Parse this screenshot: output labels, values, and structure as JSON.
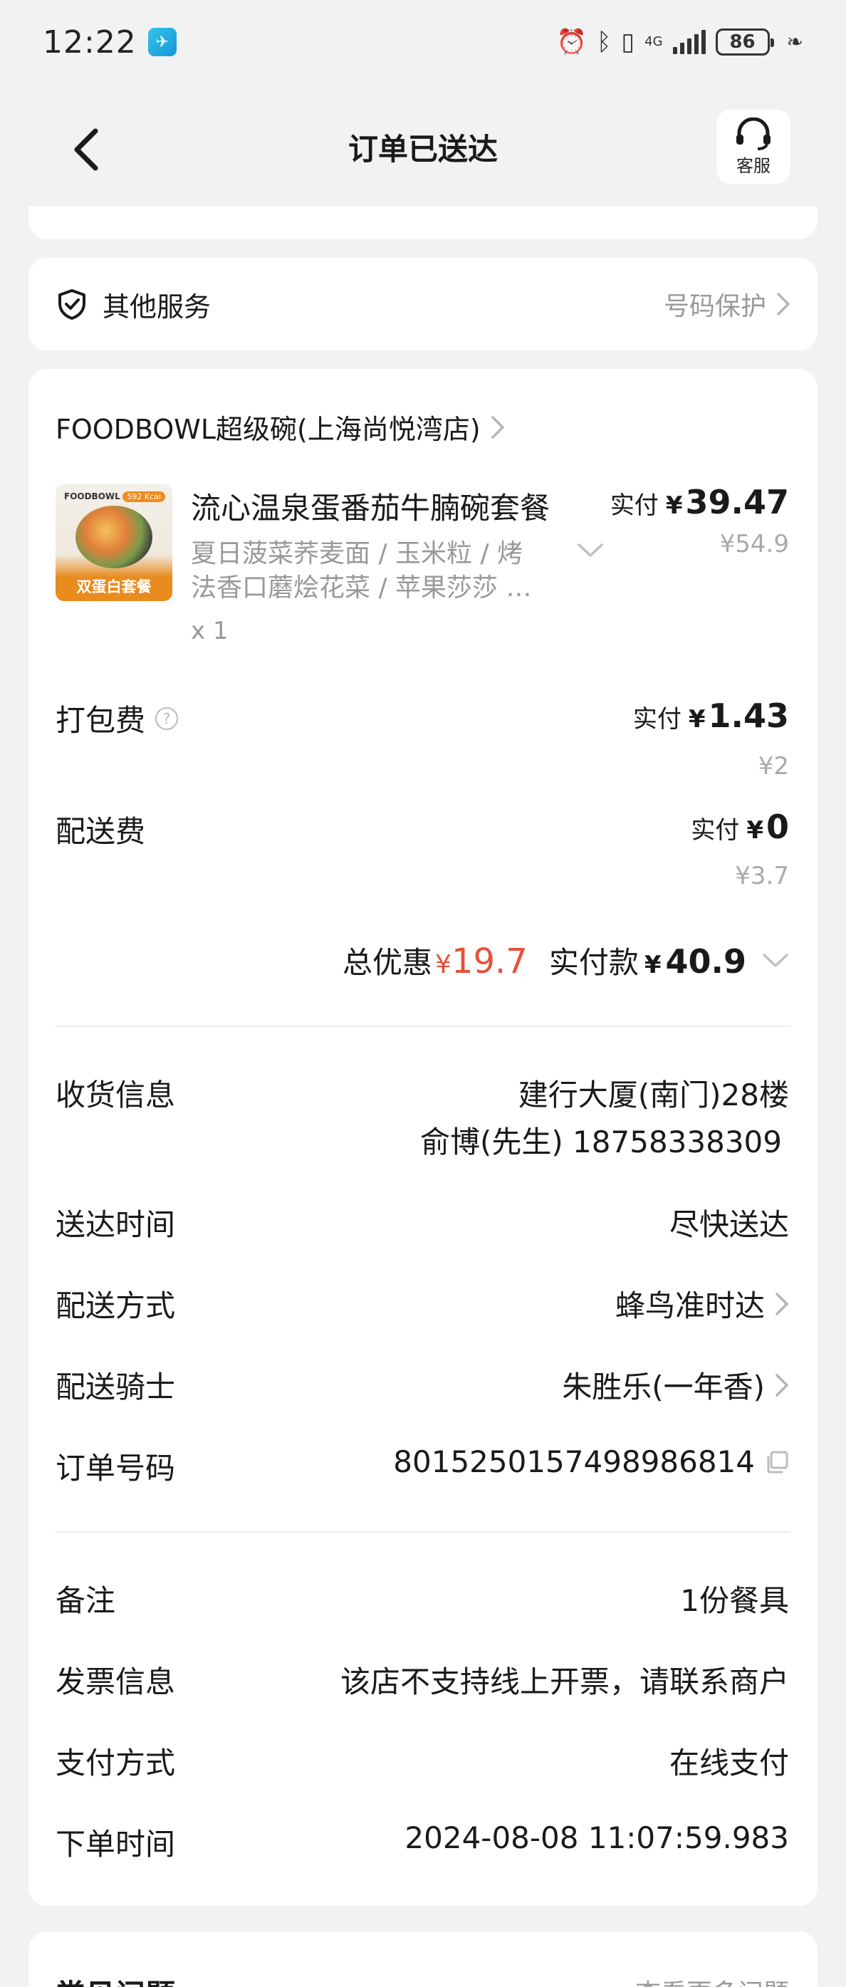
{
  "status_bar": {
    "time": "12:22",
    "network": "4G",
    "battery": "86",
    "icons": [
      "alarm-icon",
      "bluetooth-icon",
      "vibrate-icon",
      "signal-icon",
      "battery-icon",
      "leaf-icon"
    ]
  },
  "header": {
    "title": "订单已送达",
    "customer_service": "客服"
  },
  "services": {
    "label": "其他服务",
    "right_text": "号码保护"
  },
  "order": {
    "store_name": "FOODBOWL超级碗(上海尚悦湾店)",
    "item": {
      "image_brand": "FOODBOWL",
      "image_kcal": "592 Kcal",
      "image_tag": "双蛋白套餐",
      "name": "流心温泉蛋番茄牛腩碗套餐",
      "desc_line1": "夏日菠菜荞麦面 / 玉米粒 / 烤",
      "desc_line2": "法香口蘑烩花菜 / 苹果莎莎 …",
      "qty": "x 1",
      "paid_label": "实付",
      "paid_yen": "¥",
      "paid_amount": "39.47",
      "original_price": "¥54.9"
    },
    "packing": {
      "label": "打包费",
      "paid_label": "实付",
      "paid_yen": "¥",
      "paid_amount": "1.43",
      "original_price": "¥2"
    },
    "delivery": {
      "label": "配送费",
      "paid_label": "实付",
      "paid_yen": "¥",
      "paid_amount": "0",
      "original_price": "¥3.7"
    },
    "totals": {
      "discount_label": "总优惠",
      "discount_yen": "¥",
      "discount_amount": "19.7",
      "paid_label": "实付款",
      "paid_yen": "¥",
      "paid_amount": "40.9"
    },
    "info": {
      "receiver_label": "收货信息",
      "receiver_address": "建行大厦(南门)28楼",
      "receiver_contact": "俞博(先生) 18758338309",
      "time_label": "送达时间",
      "time_value": "尽快送达",
      "method_label": "配送方式",
      "method_value": "蜂鸟准时达",
      "rider_label": "配送骑士",
      "rider_value": "朱胜乐(一年香)",
      "order_no_label": "订单号码",
      "order_no_value": "8015250157498986814"
    },
    "extra": {
      "remark_label": "备注",
      "remark_value": "1份餐具",
      "invoice_label": "发票信息",
      "invoice_value": "该店不支持线上开票，请联系商户",
      "payment_label": "支付方式",
      "payment_value": "在线支付",
      "ordered_at_label": "下单时间",
      "ordered_at_value": "2024-08-08 11:07:59.983"
    }
  },
  "bottom_card": {
    "title": "常见问题",
    "right_text": "查看更多问题"
  },
  "colors": {
    "background": "#f2f2f2",
    "card": "#ffffff",
    "discount": "#e8503a",
    "muted": "#999999"
  }
}
